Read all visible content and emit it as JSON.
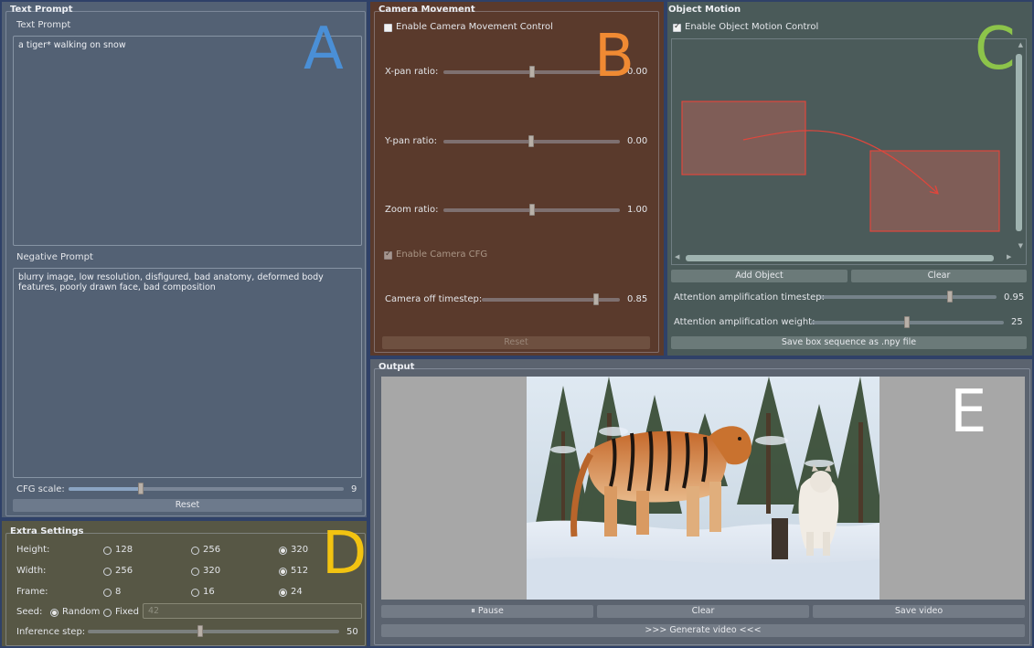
{
  "text_prompt": {
    "group_title": "Text Prompt",
    "prompt_label": "Text Prompt",
    "prompt_value": "a tiger* walking on snow",
    "negative_label": "Negative Prompt",
    "negative_value": "blurry image, low resolution, disfigured, bad anatomy, deformed body features, poorly drawn face, bad composition",
    "cfg_label": "CFG scale:",
    "cfg_value": "9",
    "cfg_fraction": 0.3,
    "reset_label": "Reset",
    "marker": "A"
  },
  "camera": {
    "group_title": "Camera Movement",
    "enable_label": "Enable Camera Movement Control",
    "enable_checked": false,
    "xpan_label": "X-pan ratio:",
    "xpan_value": "0.00",
    "ypan_label": "Y-pan ratio:",
    "ypan_value": "0.00",
    "zoom_label": "Zoom ratio:",
    "zoom_value": "1.00",
    "cfg_label": "Enable Camera CFG",
    "cfg_checked": true,
    "off_label": "Camera off timestep:",
    "off_value": "0.85",
    "reset_label": "Reset",
    "marker": "B"
  },
  "object_motion": {
    "group_title": "Object Motion",
    "enable_label": "Enable Object Motion Control",
    "enable_checked": true,
    "add_label": "Add Object",
    "clear_label": "Clear",
    "timestep_label": "Attention amplification timestep:",
    "timestep_value": "0.95",
    "weight_label": "Attention amplification weight:",
    "weight_value": "25",
    "save_label": "Save box sequence as .npy file",
    "marker": "C"
  },
  "extra": {
    "group_title": "Extra Settings",
    "height_label": "Height:",
    "height_options": [
      "128",
      "256",
      "320"
    ],
    "width_label": "Width:",
    "width_options": [
      "256",
      "320",
      "512"
    ],
    "frame_label": "Frame:",
    "frame_options": [
      "8",
      "16",
      "24"
    ],
    "seed_label": "Seed:",
    "seed_random": "Random",
    "seed_fixed": "Fixed",
    "seed_placeholder": "42",
    "steps_label": "Inference step:",
    "steps_value": "50",
    "marker": "D"
  },
  "output": {
    "group_title": "Output",
    "pause_label": "⏸ Pause",
    "clear_label": "Clear",
    "save_label": "Save video",
    "generate_label": ">>> Generate video <<<",
    "marker": "E"
  },
  "colors": {
    "panel_a": "#536174",
    "panel_b": "#5a3a2c",
    "panel_c": "#4a5a59",
    "panel_d": "#575745",
    "panel_e": "#5b636f",
    "marker_a": "#4a8fd6",
    "marker_b": "#f08a33",
    "marker_c": "#8dc44a",
    "marker_d": "#f2c311",
    "marker_e": "#ffffff",
    "box_red": "#e0463c"
  }
}
